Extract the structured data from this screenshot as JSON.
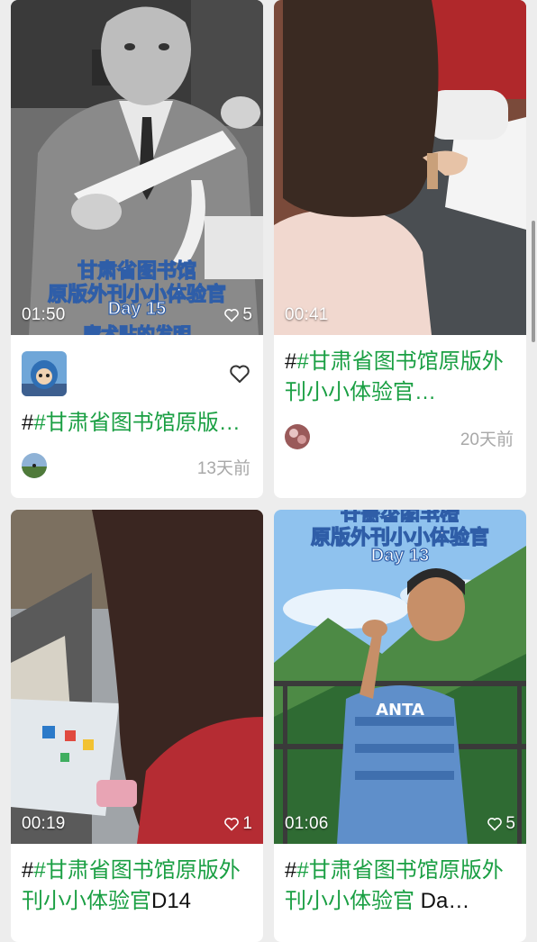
{
  "cards": [
    {
      "duration": "01:50",
      "likes": "5",
      "overlay": [
        "甘肃省图书馆",
        "原版外刊小小体验官",
        "Day 15",
        "魔术贴的发明"
      ],
      "title_tag": "#甘肃省图书馆原版…",
      "title_rest": "",
      "time": "13天前",
      "has_favorite": true
    },
    {
      "duration": "00:41",
      "likes": "",
      "title_tag": "#甘肃省图书馆原版外刊小小体验官…",
      "title_rest": "",
      "time": "20天前"
    },
    {
      "duration": "00:19",
      "likes": "1",
      "title_tag": "#甘肃省图书馆原版外刊小小体验官",
      "title_rest": "D14"
    },
    {
      "duration": "01:06",
      "likes": "5",
      "overlay": [
        "甘肃省图书馆",
        "原版外刊小小体验官",
        "Day 13"
      ],
      "shirt_text": "ANTA",
      "title_tag": "#甘肃省图书馆原版外刊小小体验官",
      "title_rest": " Da…"
    }
  ],
  "colors": {
    "tag": "#1a9f43",
    "background": "#ededed",
    "card": "#ffffff",
    "muted": "#a8a8a8"
  },
  "icons": {
    "like": "heart-outline-icon",
    "favorite": "heart-outline-icon"
  }
}
